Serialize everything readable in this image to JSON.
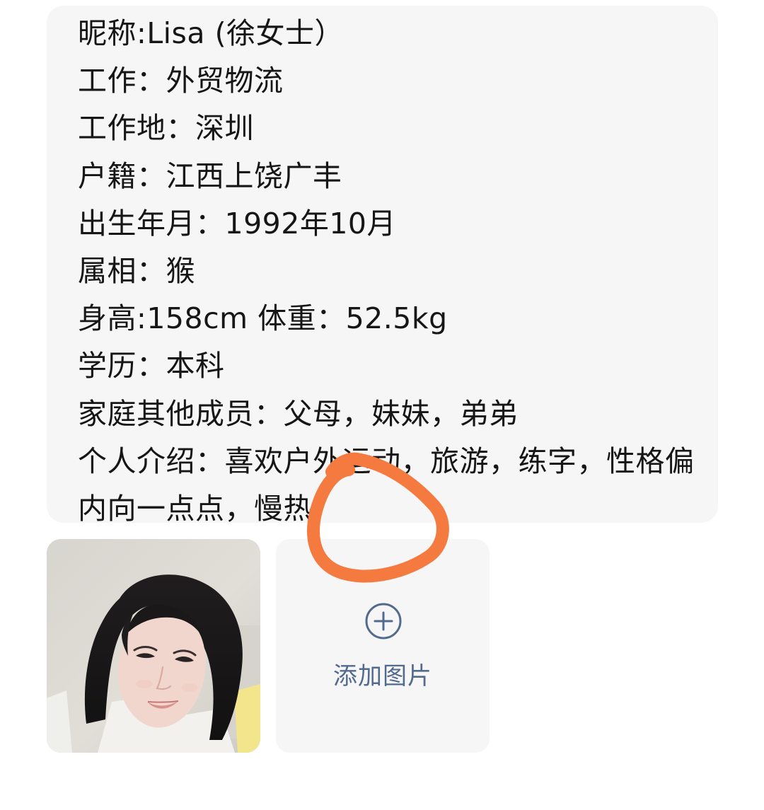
{
  "profile": {
    "details": "昵称:Lisa (徐女士）\n工作：外贸物流\n工作地：深圳\n户籍：江西上饶广丰\n出生年月：1992年10月\n属相：猴\n身高:158cm 体重：52.5kg\n学历：本科\n家庭其他成员：父母，妹妹，弟弟\n个人介绍：喜欢户外运动，旅游，练字，性格偏内向一点点，慢热"
  },
  "photos": {
    "add_label": "添加图片",
    "add_icon": "plus-circle-icon",
    "accent_color": "#536a8f"
  },
  "annotation": {
    "color": "#f47a3f"
  }
}
